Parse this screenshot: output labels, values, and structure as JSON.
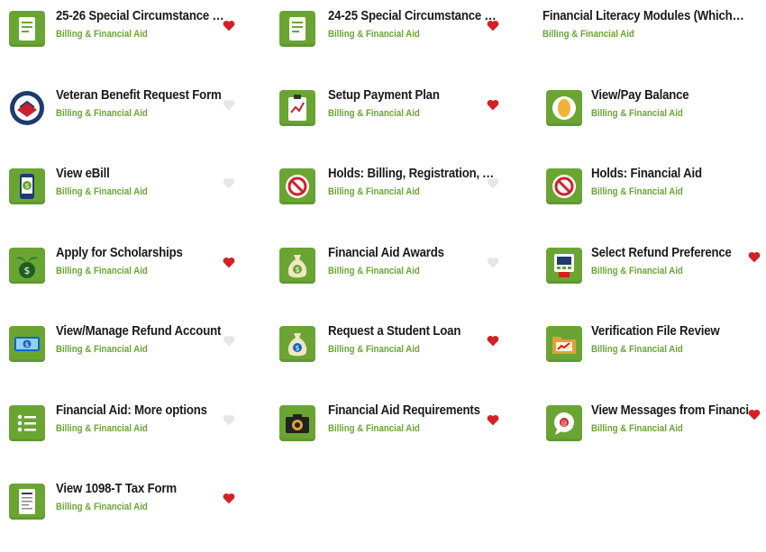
{
  "category": "Billing & Financial Aid",
  "tiles": [
    {
      "title": "25-26 Special Circumstance R...",
      "favorite": true,
      "icon": "document-icon"
    },
    {
      "title": "24-25 Special Circumstance R...",
      "favorite": true,
      "icon": "document-icon"
    },
    {
      "title": "Financial Literacy Modules (WhichWay)",
      "favorite": false,
      "icon": "none"
    },
    {
      "title": "Veteran Benefit Request Form",
      "favorite": false,
      "icon": "veteran-seal-icon"
    },
    {
      "title": "Setup Payment Plan",
      "favorite": true,
      "icon": "clipboard-chart-icon"
    },
    {
      "title": "View/Pay Balance",
      "favorite": false,
      "icon": "coin-icon"
    },
    {
      "title": "View eBill",
      "favorite": false,
      "icon": "phone-bill-icon"
    },
    {
      "title": "Holds: Billing, Registration, A...",
      "favorite": false,
      "icon": "prohibited-icon"
    },
    {
      "title": "Holds: Financial Aid",
      "favorite": false,
      "icon": "prohibited-icon"
    },
    {
      "title": "Apply for Scholarships",
      "favorite": true,
      "icon": "money-plant-icon"
    },
    {
      "title": "Financial Aid Awards",
      "favorite": false,
      "icon": "money-bag-icon"
    },
    {
      "title": "Select Refund Preference",
      "favorite": true,
      "icon": "atm-icon"
    },
    {
      "title": "View/Manage Refund Account",
      "favorite": false,
      "icon": "cash-icon"
    },
    {
      "title": "Request a Student Loan",
      "favorite": true,
      "icon": "money-bag-icon"
    },
    {
      "title": "Verification File Review",
      "favorite": false,
      "icon": "folder-chart-icon"
    },
    {
      "title": "Financial Aid: More options",
      "favorite": false,
      "icon": "list-icon"
    },
    {
      "title": "Financial Aid Requirements",
      "favorite": true,
      "icon": "camera-icon"
    },
    {
      "title": "View Messages from Financia...",
      "favorite": true,
      "icon": "chat-icon"
    },
    {
      "title": "View 1098-T Tax Form",
      "favorite": true,
      "icon": "tax-form-icon"
    }
  ]
}
